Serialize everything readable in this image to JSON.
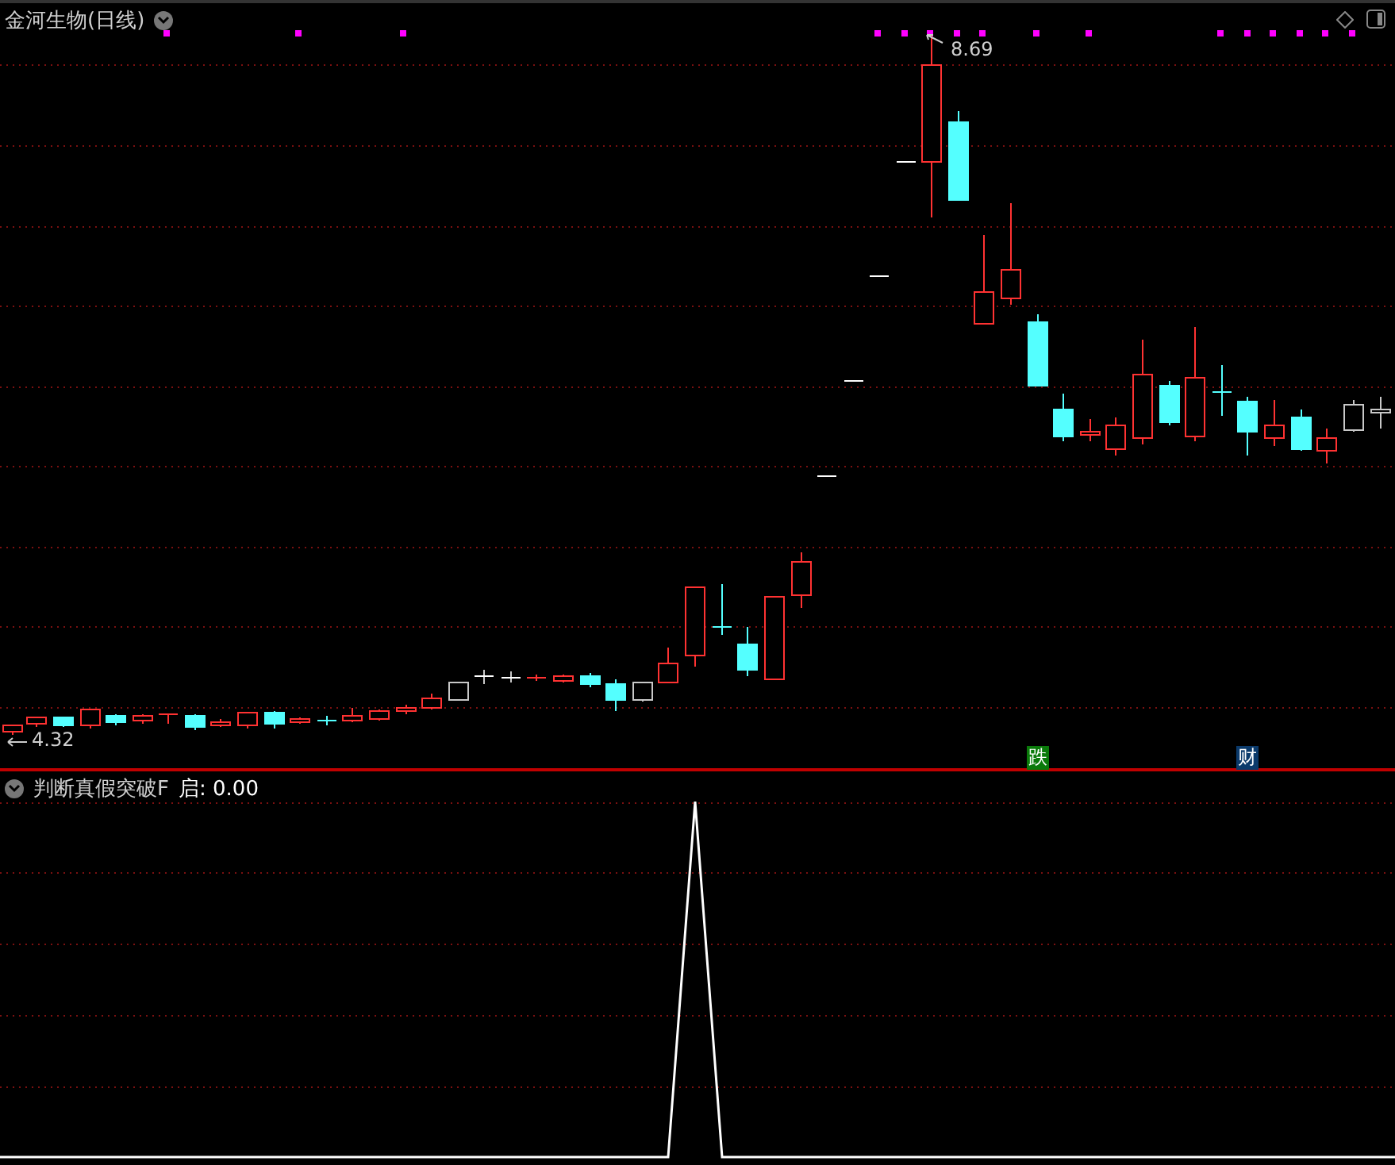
{
  "chart_title": "金河生物(日线)",
  "high_label": "8.69",
  "low_label": "4.32",
  "markers": [
    {
      "text": "跌",
      "color": "#0a7a0a"
    },
    {
      "text": "财",
      "color": "#0b3a6b"
    }
  ],
  "indicator": {
    "name": "判断真假突破F",
    "field": "启:",
    "value": "0.00"
  }
}
